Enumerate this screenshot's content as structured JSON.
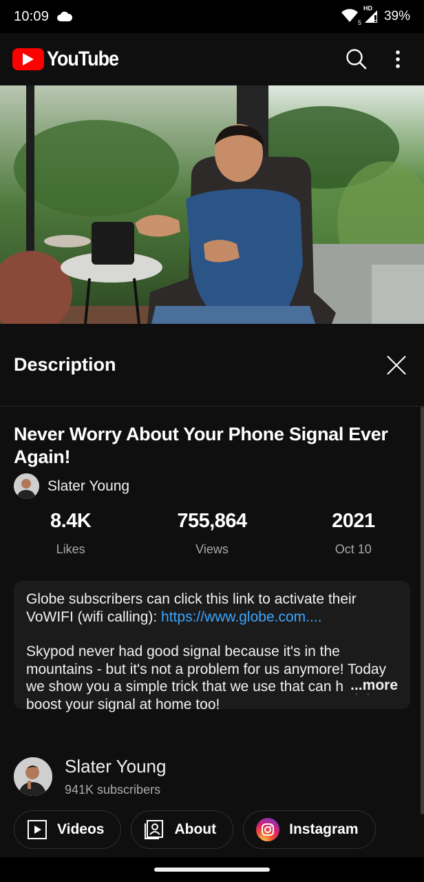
{
  "status_bar": {
    "time": "10:09",
    "network_badge": "HD",
    "wifi_badge": "5",
    "battery": "39%",
    "icons": [
      "cloud-icon",
      "wifi-icon",
      "signal-icon",
      "battery-icon"
    ]
  },
  "app_bar": {
    "logo_text": "YouTube",
    "brand_color": "#ff0000",
    "icons": [
      "search-icon",
      "more-vert-icon"
    ]
  },
  "description_panel": {
    "title": "Description",
    "video_title": "Never Worry About Your Phone Signal Ever Again!",
    "channel_name": "Slater Young",
    "stats": [
      {
        "value": "8.4K",
        "label": "Likes"
      },
      {
        "value": "755,864",
        "label": "Views"
      },
      {
        "value": "2021",
        "label": "Oct 10"
      }
    ],
    "description": {
      "para1_text": "Globe subscribers can click this link to activate their VoWIFI (wifi calling): ",
      "para1_link": "https://www.globe.com....",
      "para2_text": "Skypod never had good signal because it's in the mountains - but it's not a problem for us anymore! Today we show you a simple trick that we use that can help you boost your signal at home too!",
      "more_label": "...more",
      "link_color": "#3ea6ff"
    },
    "channel": {
      "name": "Slater Young",
      "subscribers": "941K subscribers"
    },
    "chips": [
      {
        "label": "Videos",
        "icon": "video-play-icon"
      },
      {
        "label": "About",
        "icon": "contact-card-icon"
      },
      {
        "label": "Instagram",
        "icon": "instagram-icon"
      }
    ]
  }
}
